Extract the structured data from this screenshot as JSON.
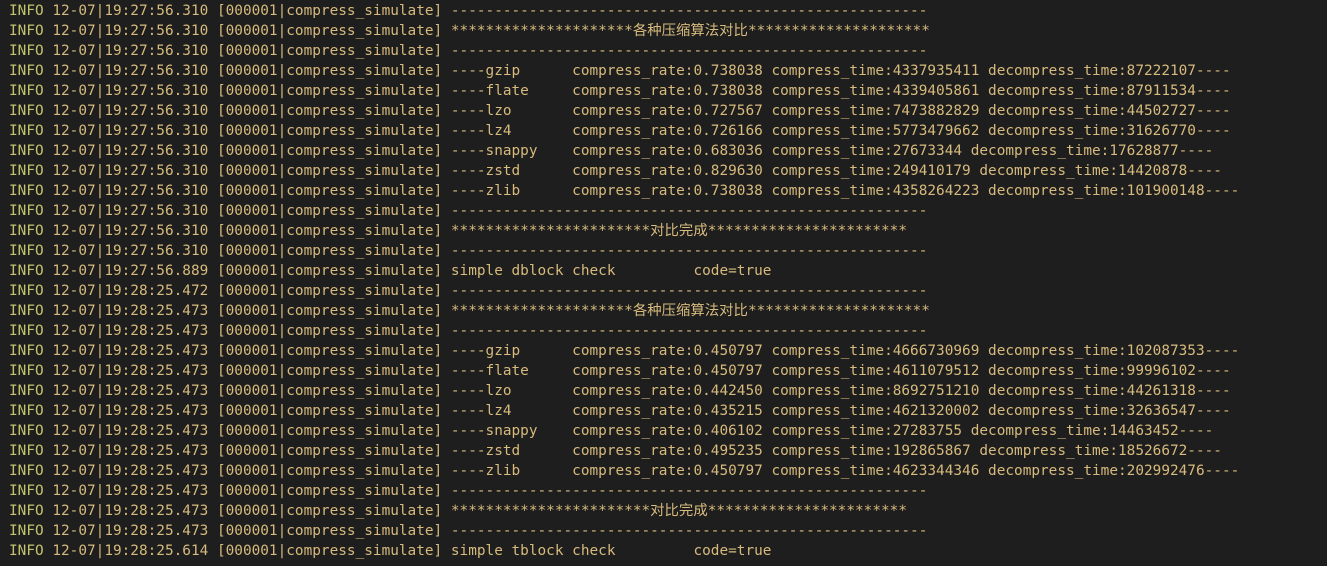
{
  "log": {
    "lines": [
      {
        "level": "INFO",
        "date": "12-07",
        "rest": "|19:27:56.310 [000001|compress_simulate] -------------------------------------------------------"
      },
      {
        "level": "INFO",
        "date": "12-07",
        "rest": "|19:27:56.310 [000001|compress_simulate] *********************各种压缩算法对比*********************"
      },
      {
        "level": "INFO",
        "date": "12-07",
        "rest": "|19:27:56.310 [000001|compress_simulate] -------------------------------------------------------"
      },
      {
        "level": "INFO",
        "date": "12-07",
        "rest": "|19:27:56.310 [000001|compress_simulate] ----gzip      compress_rate:0.738038 compress_time:4337935411 decompress_time:87222107----"
      },
      {
        "level": "INFO",
        "date": "12-07",
        "rest": "|19:27:56.310 [000001|compress_simulate] ----flate     compress_rate:0.738038 compress_time:4339405861 decompress_time:87911534----"
      },
      {
        "level": "INFO",
        "date": "12-07",
        "rest": "|19:27:56.310 [000001|compress_simulate] ----lzo       compress_rate:0.727567 compress_time:7473882829 decompress_time:44502727----"
      },
      {
        "level": "INFO",
        "date": "12-07",
        "rest": "|19:27:56.310 [000001|compress_simulate] ----lz4       compress_rate:0.726166 compress_time:5773479662 decompress_time:31626770----"
      },
      {
        "level": "INFO",
        "date": "12-07",
        "rest": "|19:27:56.310 [000001|compress_simulate] ----snappy    compress_rate:0.683036 compress_time:27673344 decompress_time:17628877----"
      },
      {
        "level": "INFO",
        "date": "12-07",
        "rest": "|19:27:56.310 [000001|compress_simulate] ----zstd      compress_rate:0.829630 compress_time:249410179 decompress_time:14420878----"
      },
      {
        "level": "INFO",
        "date": "12-07",
        "rest": "|19:27:56.310 [000001|compress_simulate] ----zlib      compress_rate:0.738038 compress_time:4358264223 decompress_time:101900148----"
      },
      {
        "level": "INFO",
        "date": "12-07",
        "rest": "|19:27:56.310 [000001|compress_simulate] -------------------------------------------------------"
      },
      {
        "level": "INFO",
        "date": "12-07",
        "rest": "|19:27:56.310 [000001|compress_simulate] ***********************对比完成***********************"
      },
      {
        "level": "INFO",
        "date": "12-07",
        "rest": "|19:27:56.310 [000001|compress_simulate] -------------------------------------------------------"
      },
      {
        "level": "INFO",
        "date": "12-07",
        "rest": "|19:27:56.889 [000001|compress_simulate] simple dblock check         code=true"
      },
      {
        "level": "INFO",
        "date": "12-07",
        "rest": "|19:28:25.472 [000001|compress_simulate] -------------------------------------------------------"
      },
      {
        "level": "INFO",
        "date": "12-07",
        "rest": "|19:28:25.473 [000001|compress_simulate] *********************各种压缩算法对比*********************"
      },
      {
        "level": "INFO",
        "date": "12-07",
        "rest": "|19:28:25.473 [000001|compress_simulate] -------------------------------------------------------"
      },
      {
        "level": "INFO",
        "date": "12-07",
        "rest": "|19:28:25.473 [000001|compress_simulate] ----gzip      compress_rate:0.450797 compress_time:4666730969 decompress_time:102087353----"
      },
      {
        "level": "INFO",
        "date": "12-07",
        "rest": "|19:28:25.473 [000001|compress_simulate] ----flate     compress_rate:0.450797 compress_time:4611079512 decompress_time:99996102----"
      },
      {
        "level": "INFO",
        "date": "12-07",
        "rest": "|19:28:25.473 [000001|compress_simulate] ----lzo       compress_rate:0.442450 compress_time:8692751210 decompress_time:44261318----"
      },
      {
        "level": "INFO",
        "date": "12-07",
        "rest": "|19:28:25.473 [000001|compress_simulate] ----lz4       compress_rate:0.435215 compress_time:4621320002 decompress_time:32636547----"
      },
      {
        "level": "INFO",
        "date": "12-07",
        "rest": "|19:28:25.473 [000001|compress_simulate] ----snappy    compress_rate:0.406102 compress_time:27283755 decompress_time:14463452----"
      },
      {
        "level": "INFO",
        "date": "12-07",
        "rest": "|19:28:25.473 [000001|compress_simulate] ----zstd      compress_rate:0.495235 compress_time:192865867 decompress_time:18526672----"
      },
      {
        "level": "INFO",
        "date": "12-07",
        "rest": "|19:28:25.473 [000001|compress_simulate] ----zlib      compress_rate:0.450797 compress_time:4623344346 decompress_time:202992476----"
      },
      {
        "level": "INFO",
        "date": "12-07",
        "rest": "|19:28:25.473 [000001|compress_simulate] -------------------------------------------------------"
      },
      {
        "level": "INFO",
        "date": "12-07",
        "rest": "|19:28:25.473 [000001|compress_simulate] ***********************对比完成***********************"
      },
      {
        "level": "INFO",
        "date": "12-07",
        "rest": "|19:28:25.473 [000001|compress_simulate] -------------------------------------------------------"
      },
      {
        "level": "INFO",
        "date": "12-07",
        "rest": "|19:28:25.614 [000001|compress_simulate] simple tblock check         code=true"
      }
    ]
  },
  "colors": {
    "background": "#1e1e1e",
    "level": "#c4c46e",
    "text": "#d7ba7d"
  }
}
